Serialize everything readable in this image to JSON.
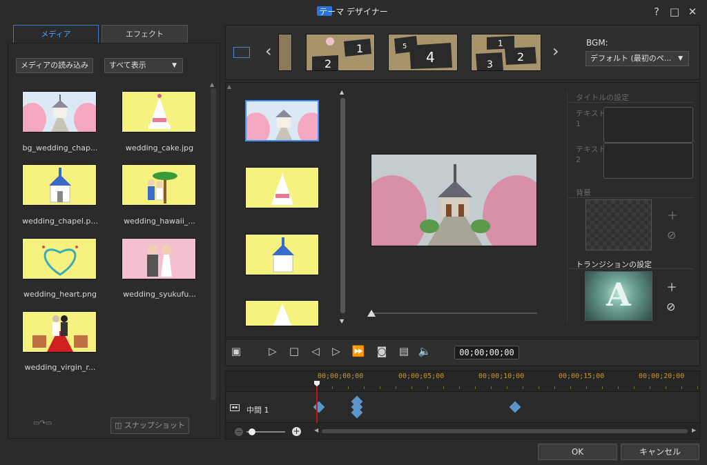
{
  "window": {
    "title": "テーマ デザイナー",
    "controls": [
      "?",
      "□",
      "✕"
    ]
  },
  "tabs": {
    "media": "メディア",
    "effect": "エフェクト"
  },
  "media": {
    "import_label": "メディアの読み込み",
    "filter_value": "すべて表示",
    "items": [
      {
        "name": "bg_wedding_chap...",
        "kind": "chapel"
      },
      {
        "name": "wedding_cake.jpg",
        "kind": "cake"
      },
      {
        "name": "wedding_chapel.p...",
        "kind": "chapel-yellow"
      },
      {
        "name": "wedding_hawaii_...",
        "kind": "hawaii"
      },
      {
        "name": "wedding_heart.png",
        "kind": "heart"
      },
      {
        "name": "wedding_syukufu...",
        "kind": "couple"
      },
      {
        "name": "wedding_virgin_r...",
        "kind": "virgin"
      }
    ],
    "snapshot_label": "スナップショット"
  },
  "templates": {
    "numbers": [
      "2",
      "1",
      "5",
      "4",
      "1",
      "2",
      "3"
    ]
  },
  "bgm": {
    "label": "BGM:",
    "value": "デフォルト (最初のペ..."
  },
  "properties": {
    "title_settings": "タイトルの設定",
    "text1": "テキスト\n1",
    "text2": "テキスト\n2",
    "background": "背景",
    "transition_settings": "トランジションの設定",
    "transition_letter": "A"
  },
  "transport": {
    "timecode": "00;00;00;00"
  },
  "timeline": {
    "ruler": [
      "00;00;00;00",
      "00;00;05;00",
      "00;00;10;00",
      "00;00;15;00",
      "00;00;20;00"
    ],
    "track_label": "中間 1"
  },
  "footer": {
    "ok": "OK",
    "cancel": "キャンセル"
  },
  "colors": {
    "accent": "#3a8eff",
    "ruler": "#c79a2c",
    "keyframe": "#5a96c8",
    "playhead": "#c01818"
  }
}
